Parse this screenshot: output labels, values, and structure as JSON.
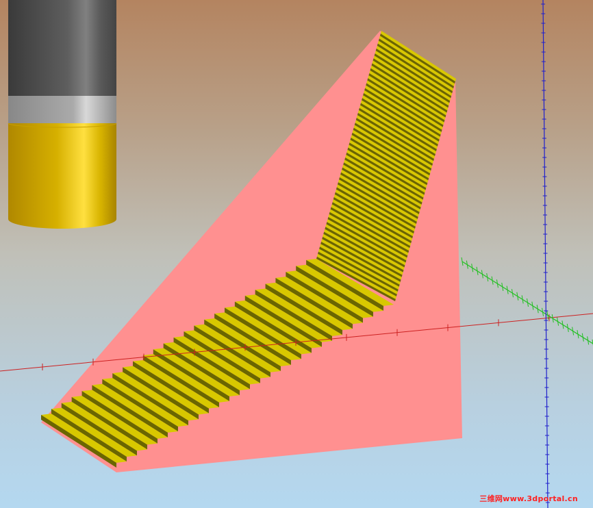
{
  "viewport": {
    "background_top_color": "#b48460",
    "background_bottom_color": "#b4d8f0"
  },
  "objects": {
    "cylinder": {
      "body_color": "#505050",
      "band_color": "#a0a0a0",
      "base_color": "#e8c020"
    },
    "staircase": {
      "tread_color": "#d8c800",
      "riser_color": "#6a6600",
      "side_color": "#ff9090"
    }
  },
  "axes": {
    "x_axis_color": "#cc2020",
    "y_axis_color": "#20c020",
    "z_axis_color": "#2020cc"
  },
  "watermark": {
    "text": "三维网www.3dportal.cn",
    "color": "#ff2020"
  }
}
